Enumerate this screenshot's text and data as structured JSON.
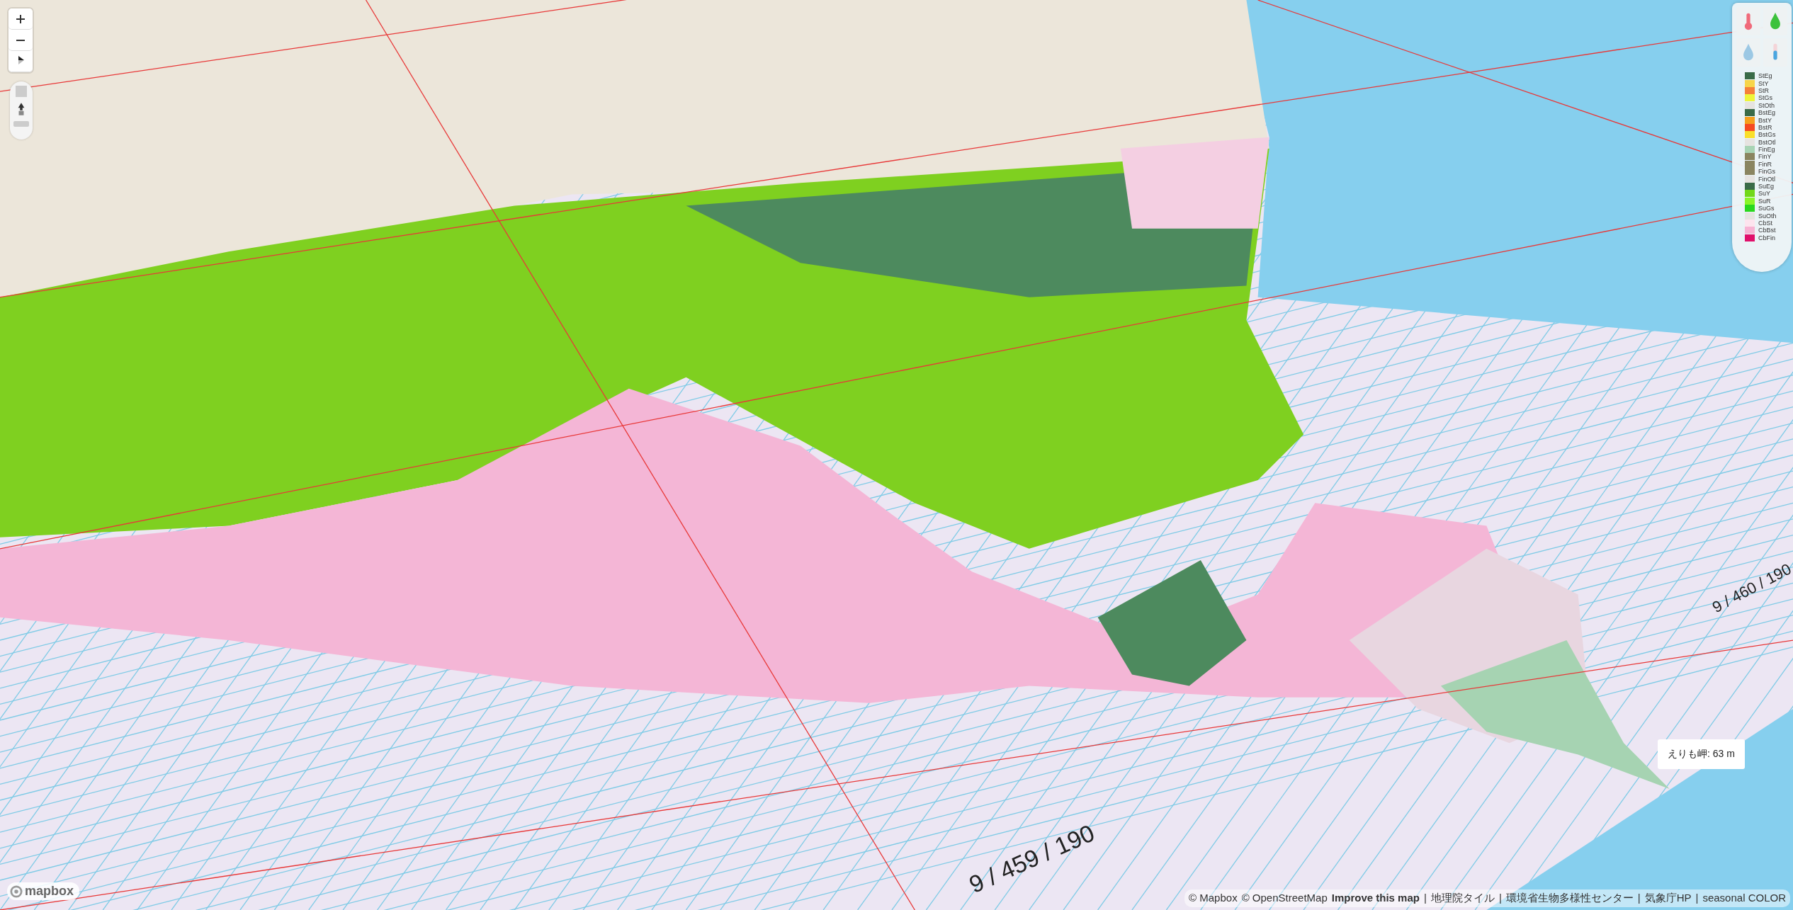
{
  "map": {
    "tile_labels": [
      {
        "text": "9 / 459 / 190",
        "kind": "large"
      },
      {
        "text": "9 / 460 / 190",
        "kind": "small"
      }
    ],
    "tooltip": "えりも岬: 63 m"
  },
  "layer_buttons": [
    {
      "kind": "thermometer",
      "selected": false
    },
    {
      "kind": "green-drop",
      "selected": false
    },
    {
      "kind": "blue-drop",
      "selected": false
    },
    {
      "kind": "gauge",
      "selected": false
    }
  ],
  "legend": [
    {
      "label": "StEg",
      "color": "#3a6b48"
    },
    {
      "label": "StY",
      "color": "#f7d54a"
    },
    {
      "label": "StR",
      "color": "#f5813a"
    },
    {
      "label": "StGs",
      "color": "#eef53a"
    },
    {
      "label": "StOth",
      "color": "#e6e3e0"
    },
    {
      "label": "BstEg",
      "color": "#3a6b48"
    },
    {
      "label": "BstY",
      "color": "#f5a01e"
    },
    {
      "label": "BstR",
      "color": "#f54a22"
    },
    {
      "label": "BstGs",
      "color": "#fadf2a"
    },
    {
      "label": "BstOtl",
      "color": "#e6e3e0"
    },
    {
      "label": "FinEg",
      "color": "#a8d4b4"
    },
    {
      "label": "FinY",
      "color": "#8a8560"
    },
    {
      "label": "FinR",
      "color": "#8a8560"
    },
    {
      "label": "FinGs",
      "color": "#8a8560"
    },
    {
      "label": "FinOtl",
      "color": "#e6e3e0"
    },
    {
      "label": "SuEg",
      "color": "#3a6b48"
    },
    {
      "label": "SuY",
      "color": "#72d81a"
    },
    {
      "label": "SuR",
      "color": "#8af52a"
    },
    {
      "label": "SuGs",
      "color": "#2ad81e"
    },
    {
      "label": "SuOth",
      "color": "#e6e3e0"
    },
    {
      "label": "CbSt",
      "color": "#fde4ee"
    },
    {
      "label": "CbBst",
      "color": "#f7b3d3"
    },
    {
      "label": "CbFin",
      "color": "#e0106b"
    }
  ],
  "logo": "mapbox",
  "attribution": [
    {
      "text": "© Mapbox",
      "kind": "link"
    },
    {
      "text": "© OpenStreetMap",
      "kind": "link"
    },
    {
      "text": "Improve this map",
      "kind": "strong"
    },
    {
      "text": "|",
      "kind": "sep"
    },
    {
      "text": "地理院タイル",
      "kind": "link"
    },
    {
      "text": "|",
      "kind": "sep"
    },
    {
      "text": "環境省生物多様性センター",
      "kind": "link"
    },
    {
      "text": "|",
      "kind": "sep"
    },
    {
      "text": "気象庁HP",
      "kind": "link"
    },
    {
      "text": "|",
      "kind": "sep"
    },
    {
      "text": "seasonal COLOR",
      "kind": "link"
    }
  ]
}
